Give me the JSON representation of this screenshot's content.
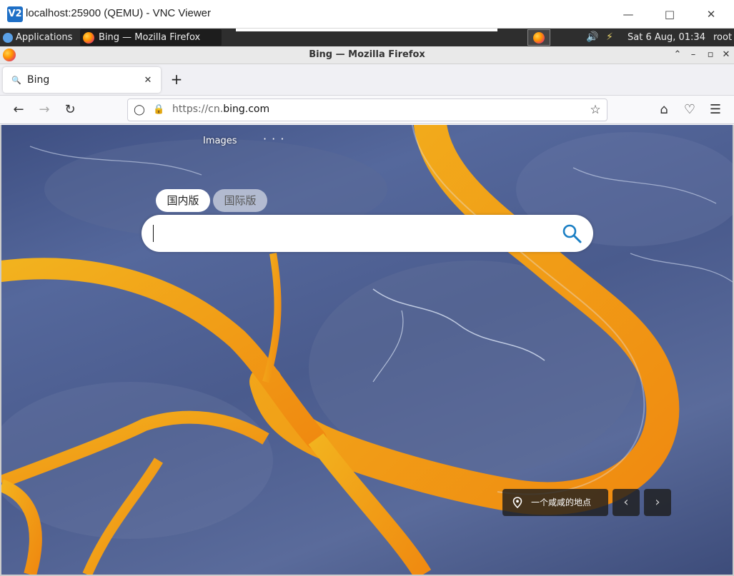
{
  "vnc": {
    "logo": "V2",
    "title": "localhost:25900 (QEMU) - VNC Viewer",
    "minimize_icon": "minimize-icon",
    "maximize_icon": "maximize-icon",
    "close_icon": "close-icon"
  },
  "panel": {
    "applications_label": "Applications",
    "task_label": "Bing — Mozilla Firefox",
    "clock": "Sat  6 Aug, 01:34",
    "user": "root"
  },
  "firefox": {
    "window_title": "Bing — Mozilla Firefox",
    "tab": {
      "label": "Bing",
      "close": "✕"
    },
    "new_tab": "+",
    "url": {
      "prefix": "https://cn.",
      "domain": "bing.com"
    }
  },
  "bing": {
    "images_link": "Images",
    "more": "· · ·",
    "scope_domestic": "国内版",
    "scope_international": "国际版",
    "search_value": "",
    "caption": "一个咸咸的地点",
    "prev": "‹",
    "next": "›"
  },
  "colors": {
    "river": "#f0a020",
    "land": "#4e5f92",
    "search_icon": "#1b7fc4"
  }
}
